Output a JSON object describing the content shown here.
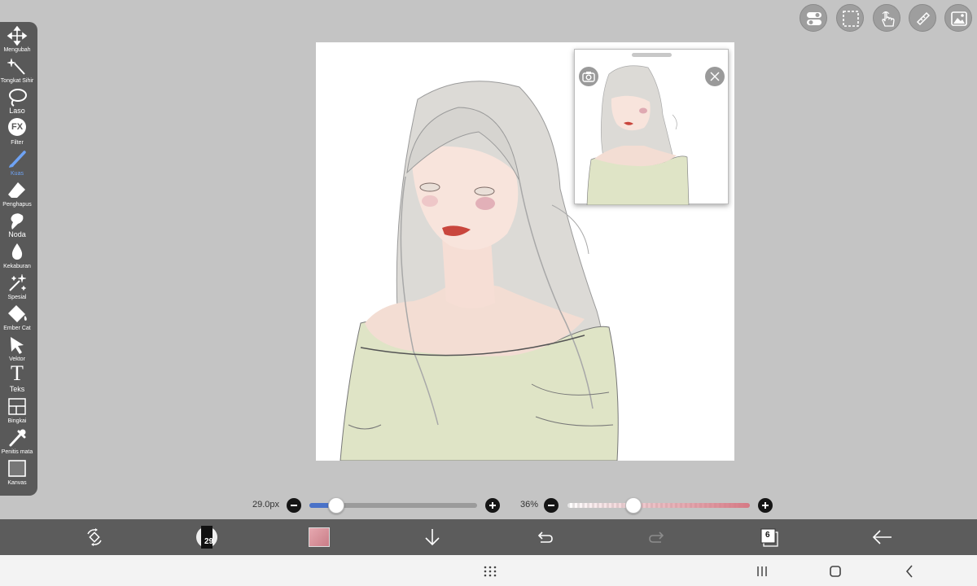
{
  "toolbar": {
    "tools": [
      {
        "label": "Mengubah",
        "icon": "move-icon"
      },
      {
        "label": "Tongkat Sihir",
        "icon": "magic-wand-icon"
      },
      {
        "label": "Laso",
        "icon": "lasso-icon"
      },
      {
        "label": "Filter",
        "icon": "fx-icon"
      },
      {
        "label": "Kuas",
        "icon": "brush-icon",
        "active": true
      },
      {
        "label": "Penghapus",
        "icon": "eraser-icon"
      },
      {
        "label": "Noda",
        "icon": "smudge-icon"
      },
      {
        "label": "Kekaburan",
        "icon": "blur-drop-icon"
      },
      {
        "label": "Spesial",
        "icon": "sparkle-wand-icon"
      },
      {
        "label": "Ember Cat",
        "icon": "paint-bucket-icon"
      },
      {
        "label": "Vektor",
        "icon": "vector-cursor-icon"
      },
      {
        "label": "Teks",
        "icon": "text-icon"
      },
      {
        "label": "Bingkai",
        "icon": "frame-icon"
      },
      {
        "label": "Penitis mata",
        "icon": "eyedropper-icon"
      },
      {
        "label": "Kanvas",
        "icon": "canvas-icon"
      }
    ],
    "fx_glyph": "FX",
    "text_glyph": "T"
  },
  "top_buttons": [
    "toggle-icon",
    "selection-icon",
    "hand-touch-icon",
    "ruler-pencil-icon",
    "gallery-icon"
  ],
  "sliders": {
    "size_label": "29.0px",
    "size_fraction": 0.16,
    "opacity_label": "36%",
    "opacity_fraction": 0.36
  },
  "bottom_bar": {
    "brush_size_badge": "29",
    "layers_count": "6",
    "icons": [
      "transform-icon",
      "brush-preview-icon",
      "color-swatch-icon",
      "download-icon",
      "undo-icon",
      "redo-icon",
      "layers-icon",
      "back-arrow-icon"
    ]
  },
  "nav_bar": [
    "apps-grid-icon",
    "recents-icon",
    "home-icon",
    "nav-back-icon"
  ],
  "colors": {
    "accent": "#6fa3f4",
    "toolbar_bg": "#595959",
    "bottom_bar_bg": "#5c5c5c",
    "canvas_bg": "#ffffff",
    "size_track_fill": "#4a72c8",
    "opacity_track": "#d57a85"
  }
}
